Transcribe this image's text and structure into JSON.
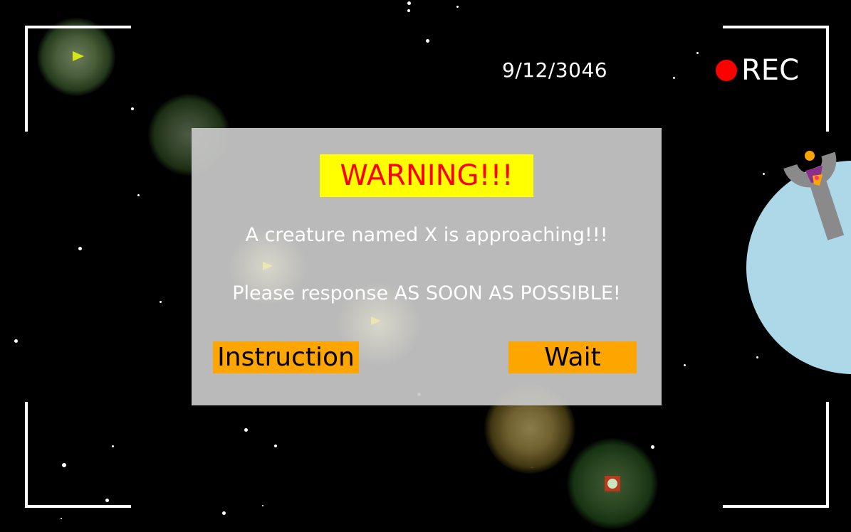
{
  "hud": {
    "date": "9/12/3046",
    "rec_label": "REC",
    "rec_color": "#ff0000"
  },
  "dialog": {
    "warning_title": "WARNING!!!",
    "message_line1": "A creature named X is approaching!!!",
    "message_line2": "Please response AS SOON AS POSSIBLE!",
    "instruction_button": "Instruction",
    "wait_button": "Wait"
  },
  "colors": {
    "background": "#000000",
    "warning_bg": "#ffff00",
    "warning_text": "#ff0000",
    "button_bg": "#ffa500",
    "dialog_bg": "#c8c8c8",
    "planet": "#acd8e8"
  },
  "icons": [
    "play-triangle-icon",
    "record-dot-icon",
    "target-square-icon"
  ]
}
